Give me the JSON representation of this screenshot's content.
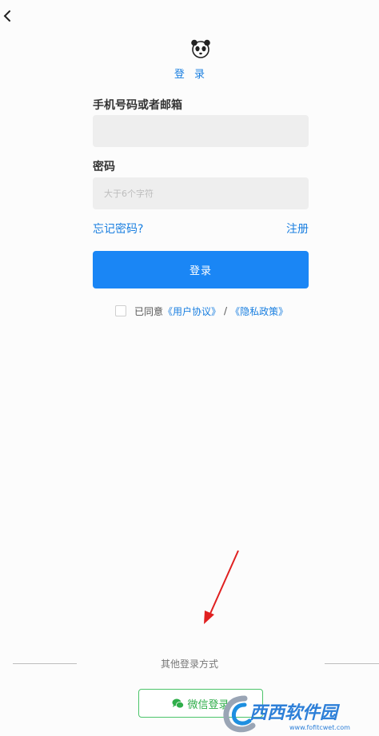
{
  "header": {
    "back_icon": "chevron-left-icon",
    "logo_icon": "panda-icon",
    "title": "登 录"
  },
  "form": {
    "account_label": "手机号码或者邮箱",
    "account_value": "",
    "password_label": "密码",
    "password_placeholder": "大于6个字符",
    "forgot_label": "忘记密码?",
    "register_label": "注册",
    "login_label": "登录"
  },
  "agreement": {
    "prefix": "已同意",
    "user_agreement": "《用户协议》",
    "separator": "/",
    "privacy_policy": "《隐私政策》"
  },
  "other": {
    "label": "其他登录方式",
    "wechat_label": "微信登录",
    "wechat_icon": "wechat-icon"
  },
  "watermark": {
    "brand": "西西软件园",
    "url": "www.fofitcwet.com"
  },
  "colors": {
    "accent": "#1a86f5",
    "link": "#1a7fe0",
    "wechat": "#2fae4a",
    "arrow": "#e02020"
  }
}
